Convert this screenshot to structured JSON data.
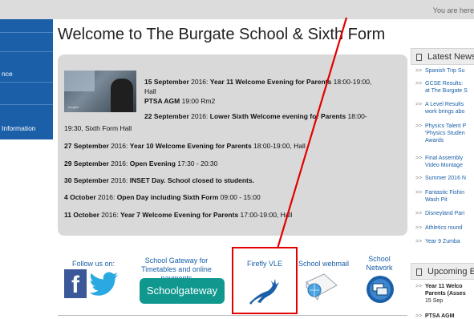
{
  "topbar": {
    "breadcrumb_prefix": "You are here"
  },
  "sidebar": {
    "items": [
      {
        "label": "nce"
      },
      {
        "label": "Information"
      }
    ]
  },
  "page": {
    "title": "Welcome to The Burgate School & Sixth Form"
  },
  "events": {
    "items": [
      {
        "date": "15 September",
        "year": " 2016: ",
        "title": "Year 11 Welcome Evening for Parents",
        "time": " 18:00-19:00,",
        "extra1": "Hall",
        "extra2_bold": "PTSA AGM",
        "extra2": " 19:00 Rm2"
      },
      {
        "date": "22 September",
        "year": " 2016: ",
        "title": "Lower Sixth Welcome evening for Parents",
        "time": " 18:00-",
        "cont": "19:30, Sixth Form Hall"
      },
      {
        "date": "27 September",
        "year": " 2016: ",
        "title": "Year 10 Welcome Evening for Parents",
        "time": " 18:00-19:00, Hall"
      },
      {
        "date": "29 September",
        "year": " 2016: ",
        "title": "Open Evening",
        "time": " 17:30 - 20:30"
      },
      {
        "date": "30 September",
        "year": " 2016: ",
        "title": "INSET Day. School closed to students.",
        "time": ""
      },
      {
        "date": "4 October",
        "year": " 2016: ",
        "title": "Open Day including Sixth Form",
        "time": " 09:00 - 15:00"
      },
      {
        "date": "11 October",
        "year": " 2016: ",
        "title": "Year 7 Welcome Evening for Parents",
        "time": " 17:00-19:00, Hall"
      }
    ],
    "image_tag": "burgate"
  },
  "links": {
    "follow": "Follow us on:",
    "facebook_glyph": "f",
    "gateway_label": "School Gateway for Timetables and online payments",
    "gateway_logo": "Schoolgateway",
    "firefly_label": "Firefly VLE",
    "webmail_label": "School webmail",
    "network_label": "School Network"
  },
  "news": {
    "heading": "Latest News",
    "items": [
      {
        "text": "Spanish Trip Su"
      },
      {
        "text": "GCSE Results:",
        "text2": "at The Burgate S"
      },
      {
        "text": "A Level Results",
        "text2": "work brings abo"
      },
      {
        "text": "Physics Talent P",
        "text2": "'Physics Studen",
        "text3": "Awards"
      },
      {
        "text": "Final Assembly",
        "text2": "Video Montage"
      },
      {
        "text": "Summer 2016 N"
      },
      {
        "text": "Fantastic Fishin",
        "text2": "Wash Pit"
      },
      {
        "text": "Disneyland Pari"
      },
      {
        "text": "Athletics round"
      },
      {
        "text": "Year 9 Zumba"
      }
    ]
  },
  "upcoming": {
    "heading": "Upcoming E",
    "items": [
      {
        "text": "Year 11 Welco",
        "text2": "Parents (Asses",
        "date": "15 Sep"
      },
      {
        "text": "PTSA AGM"
      }
    ]
  },
  "colors": {
    "link": "#1a5fa8",
    "sidebar": "#1a5fa8",
    "annotation": "#e20000",
    "gateway": "#10988f"
  }
}
